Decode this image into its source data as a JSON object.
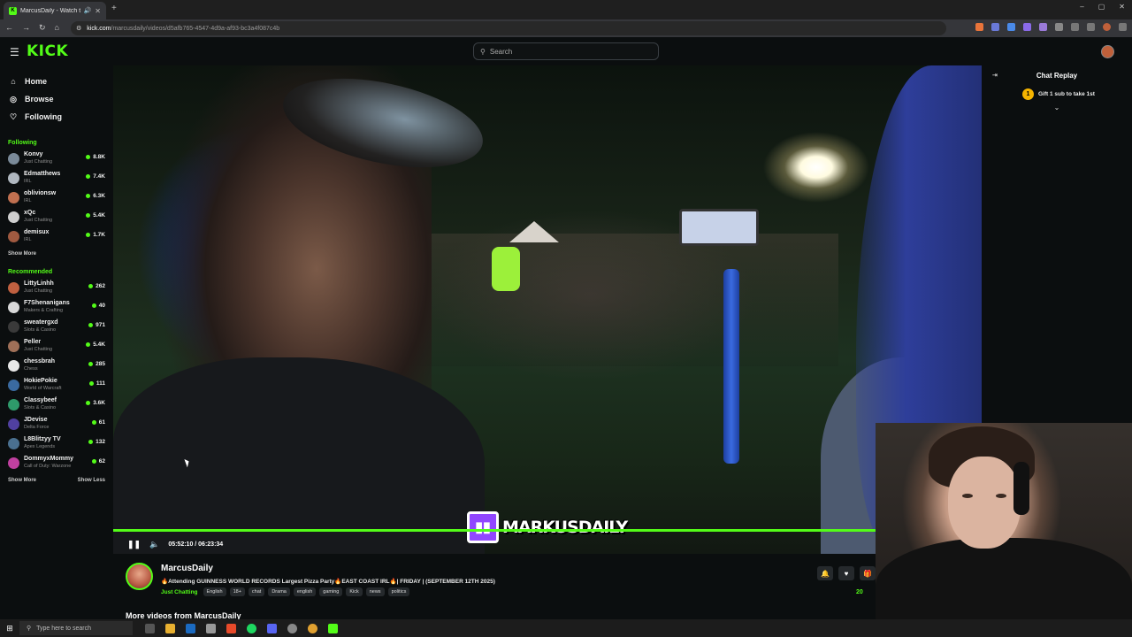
{
  "browser": {
    "tab_title": "MarcusDaily - Watch the V",
    "tab_close": "✕",
    "new_tab": "+",
    "url_host": "kick.com",
    "url_path": "/marcusdaily/videos/d5afb765-4547-4d9a-af93-bc3a4f087c4b",
    "window_controls": [
      "–",
      "▢",
      "✕"
    ]
  },
  "header": {
    "logo": "KICK",
    "search_placeholder": "Search"
  },
  "sidebar": {
    "nav": [
      {
        "icon": "home-icon",
        "label": "Home"
      },
      {
        "icon": "compass-icon",
        "label": "Browse"
      },
      {
        "icon": "heart-icon",
        "label": "Following"
      }
    ],
    "following_title": "Following",
    "following": [
      {
        "name": "Konvy",
        "category": "Just Chatting",
        "viewers": "8.8K",
        "color": "#7a8a99"
      },
      {
        "name": "Edmatthews",
        "category": "IRL",
        "viewers": "7.4K",
        "color": "#b0b8c0"
      },
      {
        "name": "oblivionsw",
        "category": "IRL",
        "viewers": "6.3K",
        "color": "#c07050"
      },
      {
        "name": "xQc",
        "category": "Just Chatting",
        "viewers": "5.4K",
        "color": "#cfcfcf"
      },
      {
        "name": "demisux",
        "category": "IRL",
        "viewers": "1.7K",
        "color": "#a05a40"
      }
    ],
    "show_more": "Show More",
    "recommended_title": "Recommended",
    "recommended": [
      {
        "name": "LittyLinhh",
        "category": "Just Chatting",
        "viewers": "262",
        "color": "#c06040"
      },
      {
        "name": "F7Shenanigans",
        "category": "Makers & Crafting",
        "viewers": "40",
        "color": "#d8d8d8"
      },
      {
        "name": "sweatergxd",
        "category": "Slots & Casino",
        "viewers": "971",
        "color": "#3a3a3a"
      },
      {
        "name": "Peller",
        "category": "Just Chatting",
        "viewers": "5.4K",
        "color": "#a07058"
      },
      {
        "name": "chessbrah",
        "category": "Chess",
        "viewers": "285",
        "color": "#e8e8e8"
      },
      {
        "name": "HokiePokie",
        "category": "World of Warcraft",
        "viewers": "111",
        "color": "#3a6aa0"
      },
      {
        "name": "Classybeef",
        "category": "Slots & Casino",
        "viewers": "3.6K",
        "color": "#2e9a6a"
      },
      {
        "name": "JDevise",
        "category": "Delta Force",
        "viewers": "61",
        "color": "#5040a0"
      },
      {
        "name": "L8Blitzyy TV",
        "category": "Apex Legends",
        "viewers": "132",
        "color": "#4a7090"
      },
      {
        "name": "DommyxMommy",
        "category": "Call of Duty: Warzone",
        "viewers": "62",
        "color": "#c040a0"
      }
    ],
    "show_less": "Show Less"
  },
  "player": {
    "watermark": "MARKUSDAILY",
    "time": "05:52:10 / 06:23:34",
    "progress": 0.92
  },
  "chat": {
    "title": "Chat Replay",
    "gift_text": "Gift 1 sub to take 1st"
  },
  "stream": {
    "name": "MarcusDaily",
    "title": "🔥Attending GUINNESS WORLD RECORDS Largest Pizza Party🔥EAST COAST IRL🔥| FRIDAY | (SEPTEMBER 12TH 2025)",
    "category": "Just Chatting",
    "tags": [
      "English",
      "18+",
      "chat",
      "Drama",
      "english",
      "gaming",
      "Kick",
      "news",
      "politics"
    ],
    "more_videos": "More videos from MarcusDaily",
    "views_partial": "20"
  },
  "taskbar": {
    "search_placeholder": "Type here to search"
  }
}
